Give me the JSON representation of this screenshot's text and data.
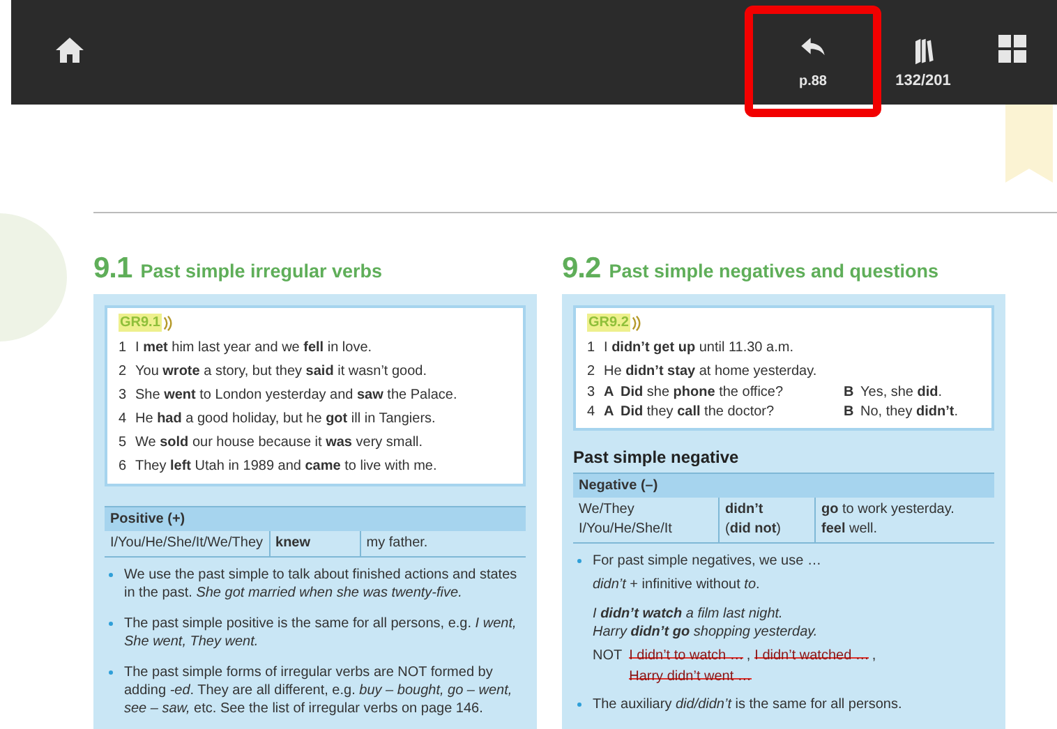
{
  "toolbar": {
    "back": {
      "label": "p.88",
      "highlighted": true
    },
    "pages": {
      "label": "132/201"
    }
  },
  "sections": [
    {
      "number": "9.1",
      "title": "Past simple irregular verbs",
      "audio_label": "GR9.1",
      "examples": [
        {
          "kind": "simple",
          "num": "1",
          "text": "I **met** him last year and we **fell** in love."
        },
        {
          "kind": "simple",
          "num": "2",
          "text": "You **wrote** a story, but they **said** it wasn’t good."
        },
        {
          "kind": "simple",
          "num": "3",
          "text": "She **went** to London yesterday and **saw** the Palace."
        },
        {
          "kind": "simple",
          "num": "4",
          "text": "He **had** a good holiday, but he **got** ill in Tangiers."
        },
        {
          "kind": "simple",
          "num": "5",
          "text": "We **sold** our house because it **was** very small."
        },
        {
          "kind": "simple",
          "num": "6",
          "text": "They **left** Utah in 1989 and **came** to live with me."
        }
      ],
      "table": {
        "header": "Positive (+)",
        "rows": [
          [
            [
              "I/You/He/She/It/We/They"
            ],
            [
              "**knew**"
            ],
            [
              "my father."
            ]
          ]
        ]
      },
      "bullets": [
        {
          "paragraphs": [
            {
              "kind": "text",
              "text": "We use the past simple to talk about finished actions and states in the past.   *She got married when she was twenty-five.*"
            }
          ]
        },
        {
          "paragraphs": [
            {
              "kind": "text",
              "text": "The past simple positive is the same for all persons, e.g. *I went, She went, They went.*"
            }
          ]
        },
        {
          "paragraphs": [
            {
              "kind": "text",
              "text": "The past simple forms of irregular verbs are NOT formed by adding *-ed*. They are all different, e.g. *buy – bought, go – went, see – saw,* etc. See the list of irregular verbs on page 146."
            }
          ]
        }
      ]
    },
    {
      "number": "9.2",
      "title": "Past simple negatives and questions",
      "audio_label": "GR9.2",
      "examples": [
        {
          "kind": "simple",
          "num": "1",
          "text": "I **didn’t get up** until 11.30 a.m."
        },
        {
          "kind": "simple",
          "num": "2",
          "text": "He **didn’t stay** at home yesterday."
        },
        {
          "kind": "dialogue",
          "num": "3",
          "a_label": "A",
          "a_text": "**Did** she **phone** the office?",
          "b_label": "B",
          "b_text": "Yes, she **did**."
        },
        {
          "kind": "dialogue",
          "num": "4",
          "a_label": "A",
          "a_text": "**Did** they **call** the doctor?",
          "b_label": "B",
          "b_text": "No, they **didn’t**."
        }
      ],
      "subheading": "Past simple negative",
      "table": {
        "header": "Negative (–)",
        "rows": [
          [
            [
              "We/They",
              "I/You/He/She/It"
            ],
            [
              "**didn’t**",
              "(**did not**)"
            ],
            [
              "**go** to work yesterday.",
              "**feel** well."
            ]
          ]
        ]
      },
      "bullets": [
        {
          "paragraphs": [
            {
              "kind": "text",
              "text": "For past simple negatives, we use …"
            },
            {
              "kind": "text",
              "text": "*didn’t* + infinitive without *to*."
            },
            {
              "kind": "example",
              "text": "I **didn’t watch** a film last night."
            },
            {
              "kind": "example",
              "text": "Harry **didn’t go** shopping yesterday."
            },
            {
              "kind": "not",
              "label": "NOT",
              "separator": ",",
              "struck": [
                "I didn’t to watch …",
                "I didn’t watched …",
                "Harry didn’t went …"
              ]
            }
          ]
        },
        {
          "paragraphs": [
            {
              "kind": "text",
              "text": "The auxiliary *did/didn’t* is the same for all persons."
            }
          ]
        }
      ]
    }
  ]
}
